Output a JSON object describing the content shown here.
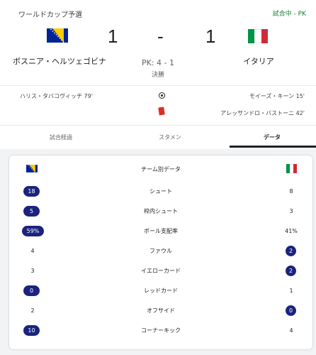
{
  "header": {
    "competition": "ワールドカップ予選",
    "status": "試合中 - PK"
  },
  "match": {
    "home": {
      "name": "ボスニア・ヘルツェゴビナ",
      "score": "1"
    },
    "away": {
      "name": "イタリア",
      "score": "1"
    },
    "separator": "-",
    "penalties": "PK: 4 - 1",
    "stage": "決勝"
  },
  "events": {
    "home_goal": "ハリス・タバコヴィッチ 79'",
    "away_goal": "モイーズ・キーン 15'",
    "away_red_card": "アレッサンドロ・バストーニ 42'"
  },
  "tabs": [
    {
      "label": "試合経過"
    },
    {
      "label": "スタメン"
    },
    {
      "label": "データ"
    }
  ],
  "stats": {
    "title": "チーム別データ",
    "rows": [
      {
        "label": "シュート",
        "home": "18",
        "away": "8",
        "leader": "home"
      },
      {
        "label": "枠内シュート",
        "home": "5",
        "away": "3",
        "leader": "home"
      },
      {
        "label": "ボール支配率",
        "home": "59%",
        "away": "41%",
        "leader": "home"
      },
      {
        "label": "ファウル",
        "home": "4",
        "away": "2",
        "leader": "away"
      },
      {
        "label": "イエローカード",
        "home": "3",
        "away": "2",
        "leader": "away"
      },
      {
        "label": "レッドカード",
        "home": "0",
        "away": "1",
        "leader": "home"
      },
      {
        "label": "オフサイド",
        "home": "2",
        "away": "0",
        "leader": "away"
      },
      {
        "label": "コーナーキック",
        "home": "10",
        "away": "4",
        "leader": "home"
      }
    ]
  },
  "colors": {
    "highlight": "#1a237e",
    "status": "#188038",
    "red_card": "#d93025",
    "italy_green": "#009246",
    "italy_red": "#ce2b37",
    "bosnia_blue": "#002395",
    "bosnia_yellow": "#fecb00"
  },
  "icons": {
    "home_flag": "bosnia-herzegovina-flag",
    "away_flag": "italy-flag",
    "goal": "soccer-ball-icon",
    "red_card": "red-card-icon"
  }
}
